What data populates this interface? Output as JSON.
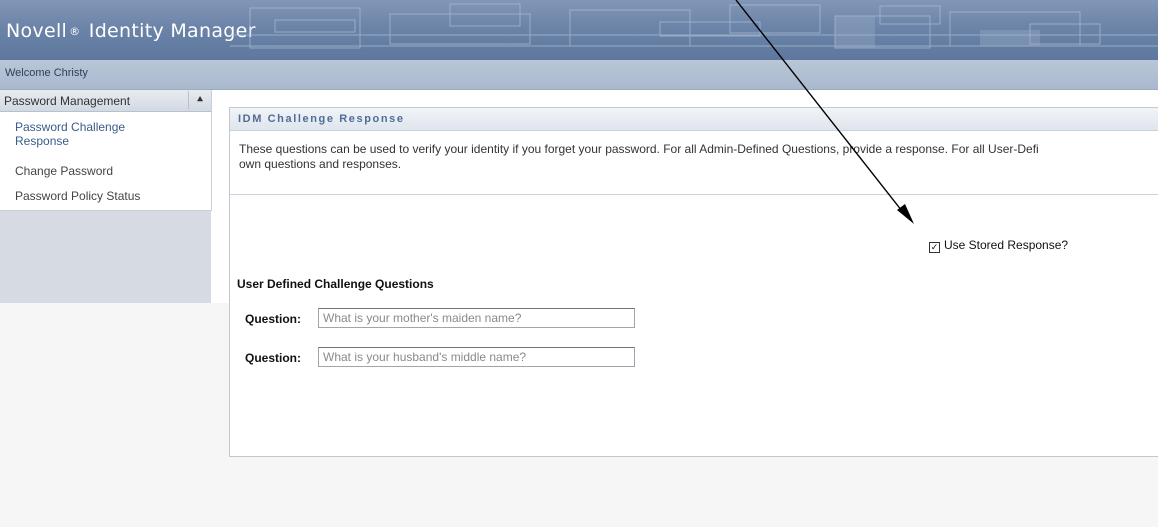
{
  "header": {
    "logo_brand": "Novell",
    "logo_reg": "®",
    "logo_product": "Identity Manager",
    "welcome": "Welcome Christy"
  },
  "sidebar": {
    "section_title": "Password Management",
    "collapse_icon": "double-chevron-up-icon",
    "items": [
      {
        "label": "Password Challenge Response"
      },
      {
        "label": "Change Password"
      },
      {
        "label": "Password Policy Status"
      }
    ]
  },
  "main": {
    "title": "IDM Challenge Response",
    "intro": "These questions can be used to verify your identity if you forget your password. For all Admin-Defined Questions, provide a response. For all User-Defi own questions and responses.",
    "intro_line1": "These questions can be used to verify your identity if you forget your password. For all Admin-Defined Questions, provide a response. For all User-Defi",
    "intro_line2": "own questions and responses.",
    "use_stored_response": {
      "label": "Use Stored Response?",
      "checked": true
    },
    "user_defined_section": "User Defined Challenge Questions",
    "questions": [
      {
        "label": "Question:",
        "placeholder": "What is your mother's maiden name?"
      },
      {
        "label": "Question:",
        "placeholder": "What is your husband's middle name?"
      }
    ]
  },
  "colors": {
    "banner": "#6c84a8",
    "welcome_bar": "#b1c0d3",
    "link": "#3a5c8a",
    "panel_title": "#4f6d96"
  }
}
